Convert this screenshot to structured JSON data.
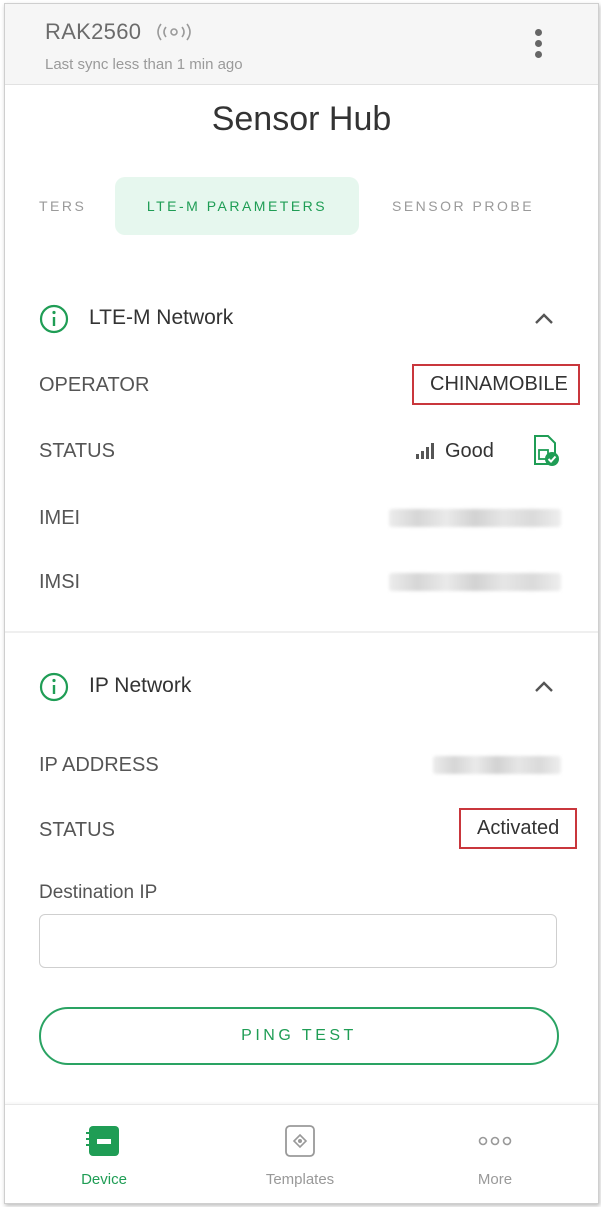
{
  "header": {
    "device_name": "RAK2560",
    "sync_text": "Last sync less than 1 min ago"
  },
  "page_title": "Sensor Hub",
  "tabs": [
    {
      "label": "TERS",
      "active": false
    },
    {
      "label": "LTE-M PARAMETERS",
      "active": true
    },
    {
      "label": "SENSOR PROBE",
      "active": false
    }
  ],
  "lte_section": {
    "title": "LTE-M Network",
    "operator_label": "OPERATOR",
    "operator_value": "CHINAMOBILE",
    "status_label": "STATUS",
    "status_value": "Good",
    "imei_label": "IMEI",
    "imsi_label": "IMSI"
  },
  "ip_section": {
    "title": "IP Network",
    "ip_label": "IP ADDRESS",
    "status_label": "STATUS",
    "status_value": "Activated",
    "destination_label": "Destination IP",
    "destination_value": "",
    "ping_label": "PING TEST"
  },
  "bottom_nav": [
    {
      "label": "Device",
      "icon": "device-icon",
      "active": true
    },
    {
      "label": "Templates",
      "icon": "templates-icon",
      "active": false
    },
    {
      "label": "More",
      "icon": "more-icon",
      "active": false
    }
  ],
  "colors": {
    "accent": "#1f9d55",
    "tab_active_bg": "#e6f7ee",
    "highlight_box": "#c9363c"
  }
}
